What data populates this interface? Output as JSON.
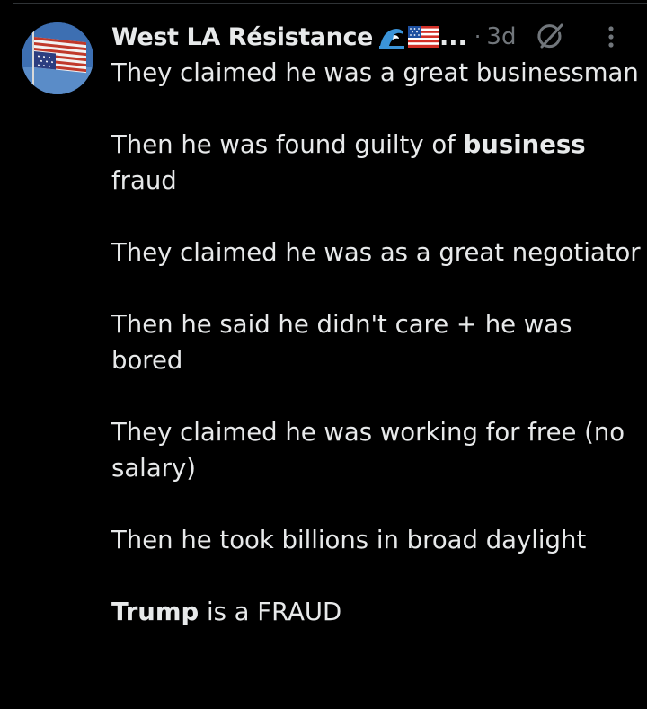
{
  "post": {
    "author": {
      "display_name": "West LA Résistance",
      "emoji": [
        "water-wave-emoji",
        "us-flag-emoji"
      ],
      "truncation": "...",
      "avatar": "upside-down-us-flag-avatar"
    },
    "separator": "·",
    "timestamp": "3d",
    "paragraphs": [
      {
        "text": "They claimed he was a great businessman"
      },
      {
        "pre": "Then he was found guilty of ",
        "bold": "business",
        "post": " fraud"
      },
      {
        "text": "They claimed he was as a great negotiator"
      },
      {
        "text": "Then he said he didn't care + he was bored"
      },
      {
        "text": "They claimed he was working for free (no salary)"
      },
      {
        "text": "Then he took billions in broad daylight"
      },
      {
        "bold": "Trump",
        "post": " is a FRAUD"
      }
    ]
  },
  "icons": {
    "grok": "grok-icon",
    "more": "more-options-icon"
  },
  "colors": {
    "background": "#000000",
    "primary_text": "#e7e9ea",
    "secondary_text": "#71767b",
    "divider": "#2f3336"
  }
}
